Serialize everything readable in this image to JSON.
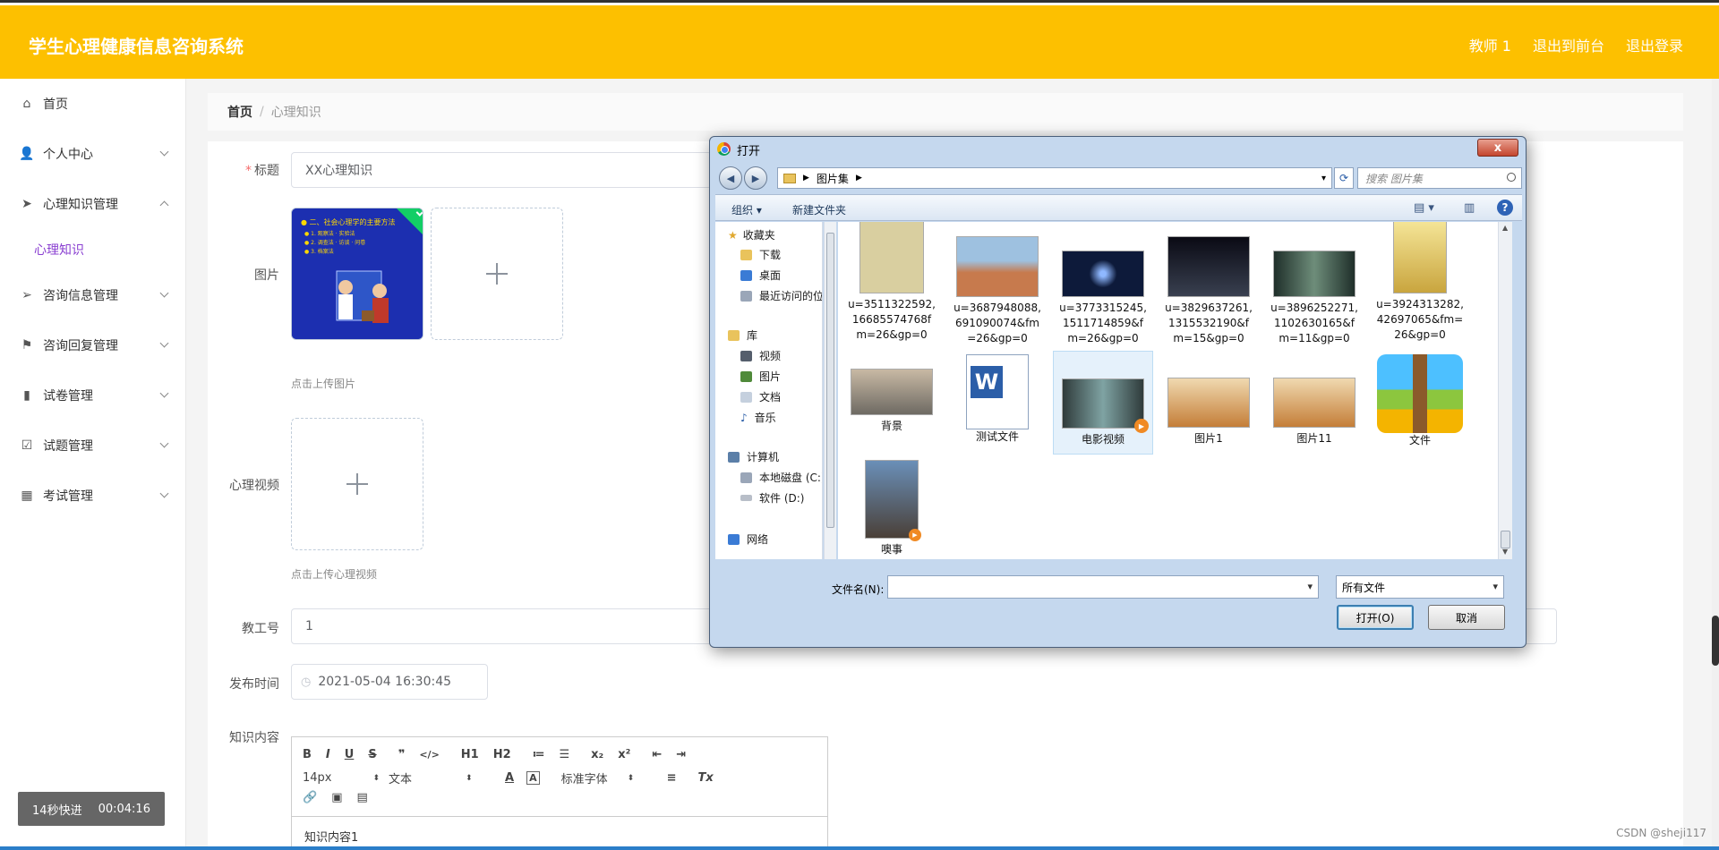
{
  "header": {
    "app_title": "学生心理健康信息咨询系统",
    "user": "教师 1",
    "to_front": "退出到前台",
    "logout": "退出登录"
  },
  "sidebar": {
    "items": [
      {
        "label": "首页",
        "icon": "home-icon"
      },
      {
        "label": "个人中心",
        "icon": "user-icon"
      },
      {
        "label": "心理知识管理",
        "icon": "send-icon",
        "expanded": true
      },
      {
        "label": "咨询信息管理",
        "icon": "send-outline-icon"
      },
      {
        "label": "咨询回复管理",
        "icon": "flag-icon"
      },
      {
        "label": "试卷管理",
        "icon": "bar-chart-icon"
      },
      {
        "label": "试题管理",
        "icon": "clipboard-icon"
      },
      {
        "label": "考试管理",
        "icon": "grid-icon"
      }
    ],
    "submenu": "心理知识",
    "timer": {
      "label": "14秒快进",
      "time": "00:04:16"
    }
  },
  "breadcrumb": {
    "home": "首页",
    "sep": "/",
    "current": "心理知识"
  },
  "form": {
    "title_label": "标题",
    "title_value": "XX心理知识",
    "image_label": "图片",
    "image_hint": "点击上传图片",
    "video_label": "心理视频",
    "video_hint": "点击上传心理视频",
    "staff_label": "教工号",
    "staff_value": "1",
    "date_label": "发布时间",
    "date_value": "2021-05-04 16:30:45",
    "content_label": "知识内容",
    "content_value": "知识内容1"
  },
  "editor": {
    "row1": [
      "B",
      "I",
      "U",
      "S",
      "❞",
      "</>",
      "H1",
      "H2",
      "≔",
      "☰",
      "x₂",
      "x²",
      "⇤",
      "⇥"
    ],
    "font_size": "14px",
    "text_type": "文本",
    "font_family": "标准字体",
    "color_btn": "A",
    "clear_btn": "Tx"
  },
  "dialog": {
    "title": "打开",
    "close": "x",
    "path": "图片集",
    "search_placeholder": "搜索 图片集",
    "organize": "组织 ▾",
    "new_folder": "新建文件夹",
    "help": "?",
    "tree": {
      "favorites": "收藏夹",
      "fav_items": [
        "下载",
        "桌面",
        "最近访问的位置"
      ],
      "library": "库",
      "lib_items": [
        "视频",
        "图片",
        "文档",
        "音乐"
      ],
      "computer": "计算机",
      "comp_items": [
        "本地磁盘 (C:)",
        "软件 (D:)"
      ],
      "network": "网络"
    },
    "files": [
      {
        "name": "u=3511322592,16685574768f m=26&gp=0",
        "l1": "u=3511322592,",
        "l2": "16685574768f",
        "l3": "m=26&gp=0"
      },
      {
        "name": "u=3687948088",
        "l1": "u=3687948088,",
        "l2": "691090074&fm",
        "l3": "=26&gp=0"
      },
      {
        "name": "u=3773315245",
        "l1": "u=3773315245,",
        "l2": "1511714859&f",
        "l3": "m=26&gp=0"
      },
      {
        "name": "u=3829637261",
        "l1": "u=3829637261,",
        "l2": "1315532190&f",
        "l3": "m=15&gp=0"
      },
      {
        "name": "u=3896252271",
        "l1": "u=3896252271,",
        "l2": "1102630165&f",
        "l3": "m=11&gp=0"
      },
      {
        "name": "u=3924313282",
        "l1": "u=3924313282,",
        "l2": "42697065&fm=",
        "l3": "26&gp=0"
      },
      {
        "l1": "背景"
      },
      {
        "l1": "测试文件"
      },
      {
        "l1": "电影视频"
      },
      {
        "l1": "图片1"
      },
      {
        "l1": "图片11"
      },
      {
        "l1": "文件"
      },
      {
        "l1": "噢事"
      }
    ],
    "filename_label": "文件名(N):",
    "filetype": "所有文件",
    "open_btn": "打开(O)",
    "cancel_btn": "取消"
  },
  "watermark": "CSDN @sheji117"
}
